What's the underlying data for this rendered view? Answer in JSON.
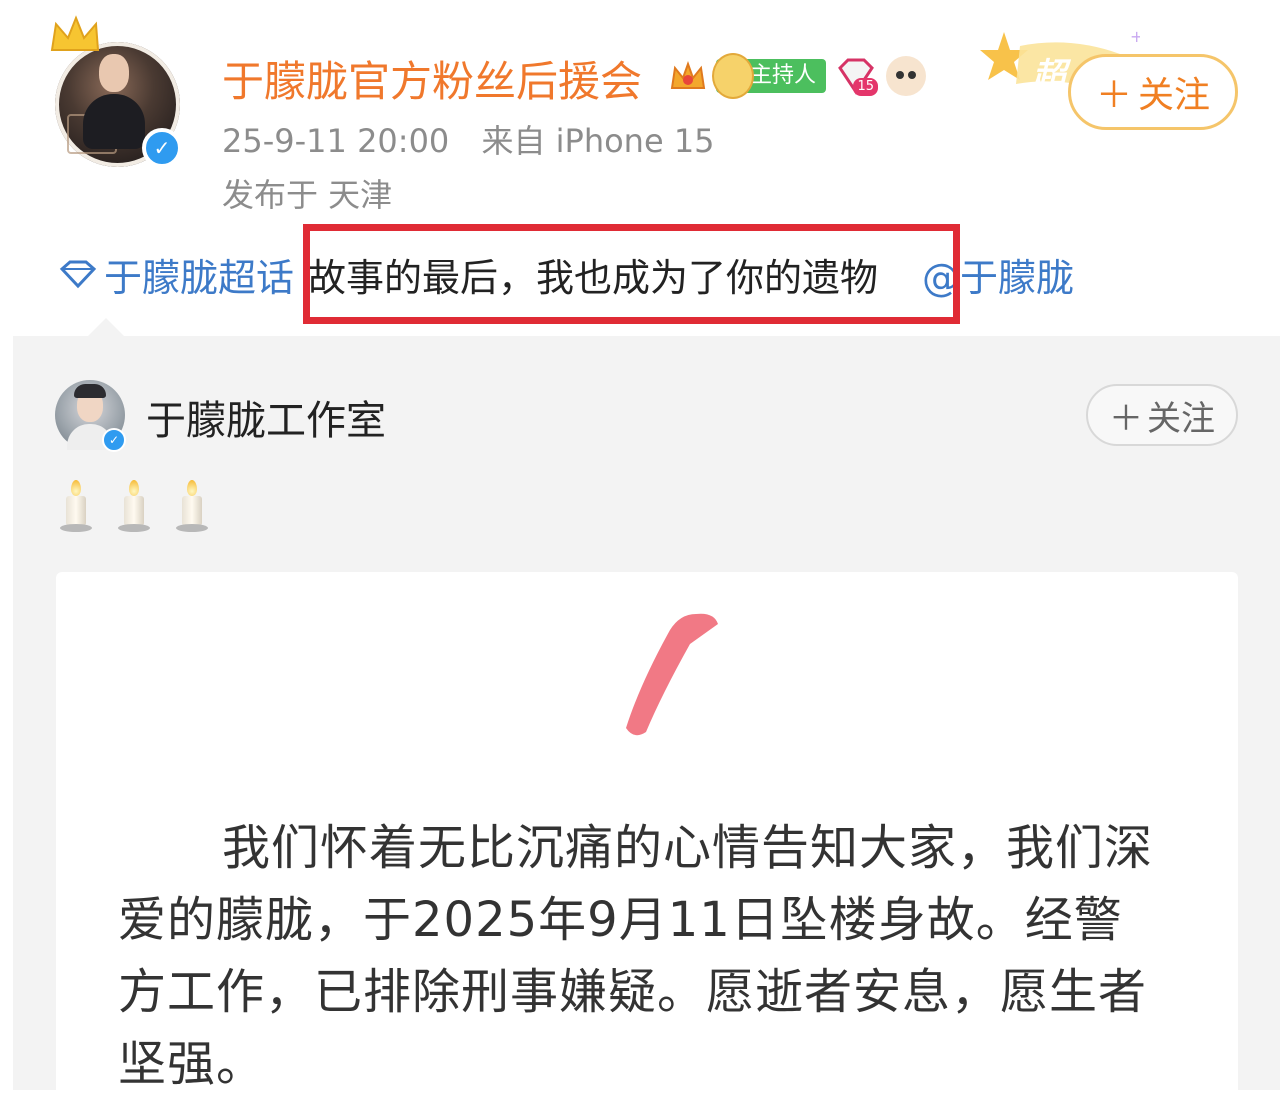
{
  "header": {
    "username": "于朦胧官方粉丝后援会",
    "badges": {
      "host_label": "主持人",
      "gem_level": "15",
      "super_label": "超"
    },
    "follow_label": "关注",
    "timestamp": "25-9-11 20:00",
    "source": "来自 iPhone 15",
    "location": "发布于 天津"
  },
  "post": {
    "topic": "于朦胧超话",
    "text": "故事的最后，我也成为了你的遗物",
    "mention": "@于朦胧"
  },
  "repost": {
    "author": "于朦胧工作室",
    "follow_label": "关注",
    "emoji": [
      "candle",
      "candle",
      "candle"
    ],
    "notice_text": "我们怀着无比沉痛的心情告知大家，我们深爱的朦胧，于2025年9月11日坠楼身故。经警方工作，已排除刑事嫌疑。愿逝者安息，愿生者坚强。"
  },
  "colors": {
    "username": "#f0782c",
    "link": "#3d7ac8",
    "highlight_border": "#e02b35",
    "meta": "#8c8c8c",
    "repost_bg": "#f3f3f3",
    "follow_main_text": "#f07f22"
  },
  "icons": [
    "crown-icon",
    "verified-icon",
    "vip-crown-icon",
    "host-badge-icon",
    "gem-level-icon",
    "pet-icon",
    "super-topic-star-icon",
    "plus-icon",
    "topic-diamond-icon",
    "candle-icon"
  ]
}
